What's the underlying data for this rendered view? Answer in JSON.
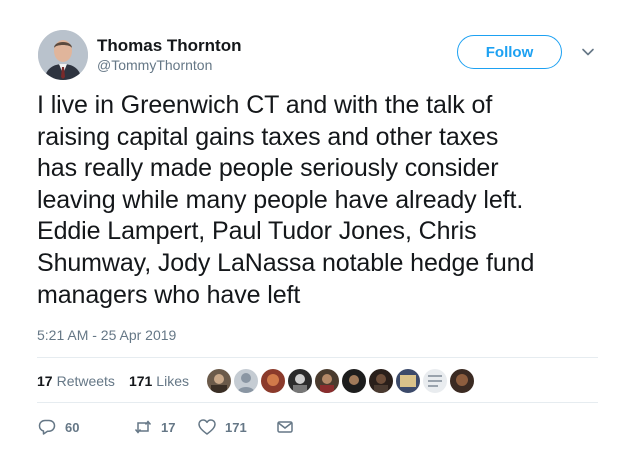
{
  "author": {
    "name": "Thomas Thornton",
    "handle": "@TommyThornton"
  },
  "follow_label": "Follow",
  "tweet": {
    "lines": [
      "I live in Greenwich CT and with the talk of",
      "raising capital gains taxes and other taxes",
      "has really made people seriously consider",
      "leaving while many people have already left.",
      "Eddie Lampert, Paul Tudor Jones, Chris",
      "Shumway, Jody LaNassa notable hedge fund",
      "managers who have left"
    ],
    "timestamp": "5:21 AM - 25 Apr 2019"
  },
  "stats": {
    "retweets_count": "17",
    "retweets_label": "Retweets",
    "likes_count": "171",
    "likes_label": "Likes"
  },
  "actions": {
    "replies": "60",
    "retweets": "17",
    "likes": "171"
  },
  "icons": [
    "avatar",
    "caret-down-icon",
    "reply-icon",
    "retweet-icon",
    "like-icon",
    "message-icon"
  ],
  "colors": {
    "accent": "#1da1f2",
    "text": "#14171a",
    "muted": "#657786",
    "divider": "#e6ecf0"
  }
}
